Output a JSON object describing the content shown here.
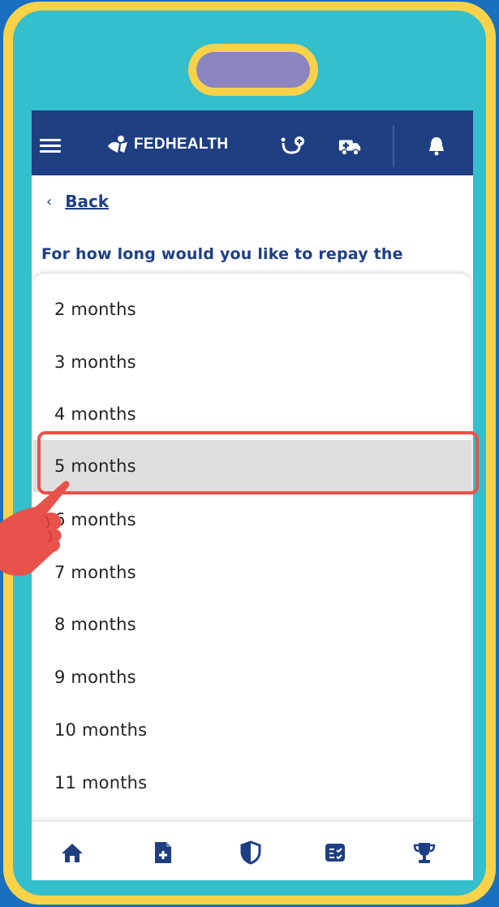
{
  "app": {
    "brand": "FEDHEALTH"
  },
  "appbar": {
    "icons": [
      "menu-icon",
      "logo-icon",
      "doctor-consult-icon",
      "ambulance-icon",
      "notification-bell-icon"
    ]
  },
  "navigation": {
    "back_label": "Back",
    "back_chevron": "‹"
  },
  "question": {
    "text": "For how long would you like to repay the"
  },
  "picker": {
    "options": [
      "2 months",
      "3 months",
      "4 months",
      "5 months",
      "6 months",
      "7 months",
      "8 months",
      "9 months",
      "10 months",
      "11 months"
    ],
    "selected": "5 months"
  },
  "bottom_nav": {
    "icons": [
      "home-icon",
      "add-document-icon",
      "shield-icon",
      "claims-card-icon",
      "trophy-icon"
    ]
  },
  "colors": {
    "brand_navy": "#1f3f83",
    "highlight": "#e8524a",
    "selected_bg": "#dedede",
    "frame_yellow": "#f9d24a",
    "frame_teal": "#33bfcc",
    "background_blue": "#1a6fbf"
  }
}
